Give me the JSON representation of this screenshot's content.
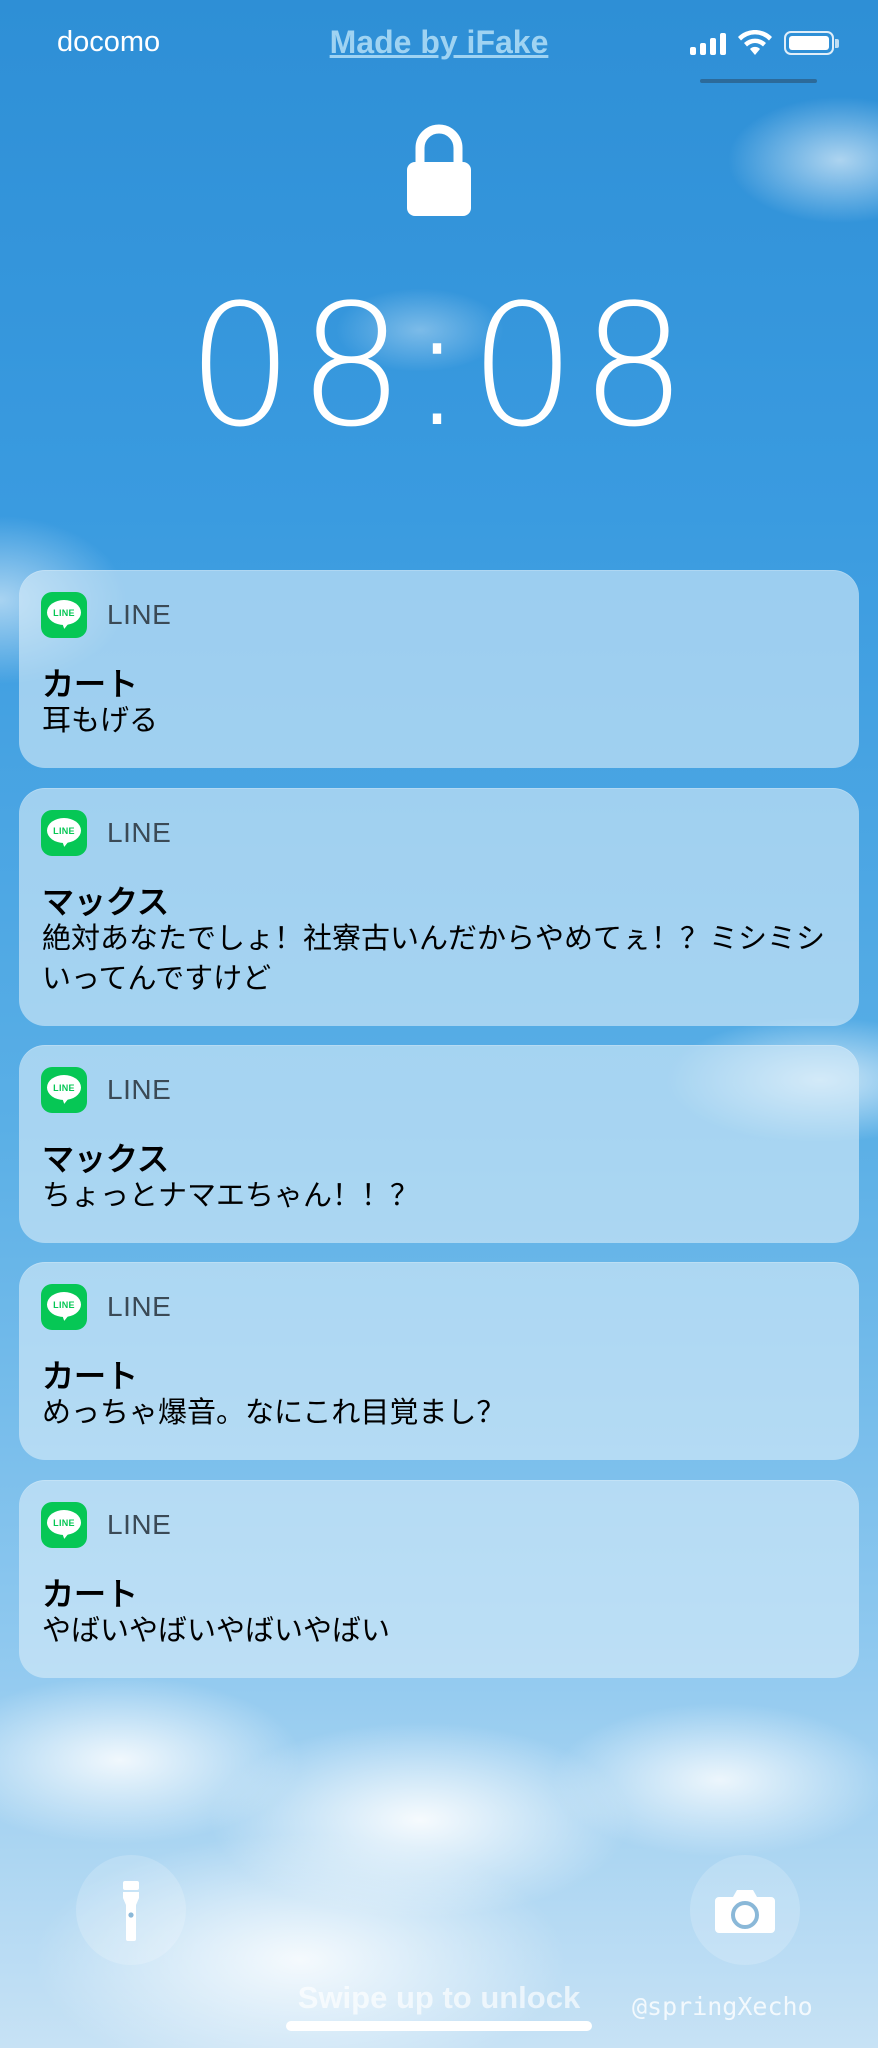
{
  "status_bar": {
    "carrier": "docomo",
    "made_by": "Made by iFake",
    "icons": [
      "signal-icon",
      "wifi-icon",
      "battery-icon"
    ]
  },
  "lock_screen": {
    "lock_icon": "lock-icon",
    "time": "08:08"
  },
  "notifications": [
    {
      "app": "LINE",
      "sender": "カート",
      "message": "耳もげる"
    },
    {
      "app": "LINE",
      "sender": "マックス",
      "message": "絶対あなたでしょ！社寮古いんだからやめてぇ！？ミシミシいってんですけど"
    },
    {
      "app": "LINE",
      "sender": "マックス",
      "message": "ちょっとナマエちゃん！！？"
    },
    {
      "app": "LINE",
      "sender": "カート",
      "message": "めっちゃ爆音。なにこれ目覚まし？"
    },
    {
      "app": "LINE",
      "sender": "カート",
      "message": "やばいやばいやばいやばい"
    }
  ],
  "bottom": {
    "flashlight_icon": "flashlight-icon",
    "camera_icon": "camera-icon",
    "swipe_hint": "Swipe up to unlock",
    "watermark": "@springXecho"
  },
  "colors": {
    "line_green": "#06c755",
    "sky_top": "#2e8fd6",
    "sky_bottom": "#c7e2f5"
  }
}
